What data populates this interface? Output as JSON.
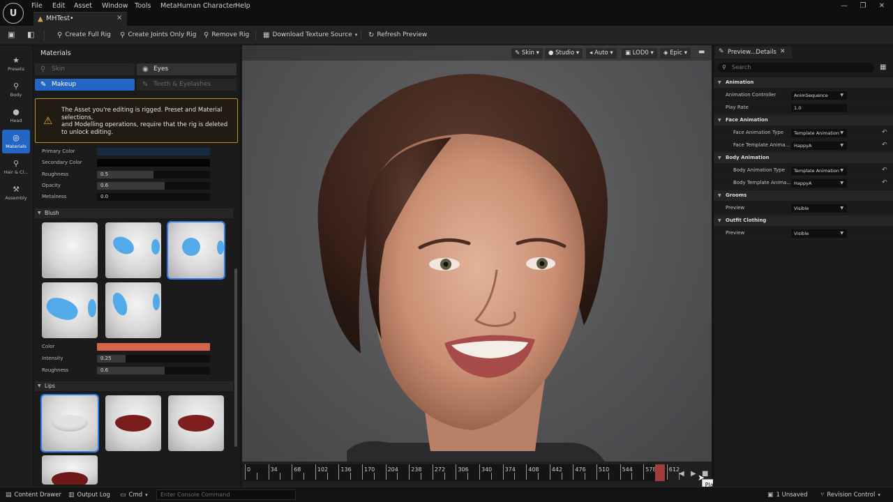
{
  "menu": {
    "items": [
      "File",
      "Edit",
      "Asset",
      "Window",
      "Tools",
      "MetaHuman Character",
      "Help"
    ]
  },
  "document_tab": {
    "label": "MHTest•",
    "close": "×"
  },
  "window_controls": {
    "minimize": "—",
    "maximize": "❐",
    "close": "✕"
  },
  "toolbar": {
    "create_full_rig": "Create Full Rig",
    "create_joints_only_rig": "Create Joints Only Rig",
    "remove_rig": "Remove Rig",
    "download_texture_source": "Download Texture Source",
    "refresh_preview": "Refresh Preview"
  },
  "left_nav": {
    "items": [
      {
        "label": "Presets",
        "icon": "★"
      },
      {
        "label": "Body",
        "icon": "⚲"
      },
      {
        "label": "Head",
        "icon": "●"
      },
      {
        "label": "Materials",
        "icon": "◎"
      },
      {
        "label": "Hair & Cl...",
        "icon": "⚲"
      },
      {
        "label": "Assembly",
        "icon": "⚒"
      }
    ]
  },
  "materials": {
    "title": "Materials",
    "tabs": {
      "skin": "Skin",
      "eyes": "Eyes",
      "makeup": "Makeup",
      "teeth": "Teeth & Eyelashes"
    },
    "warning": {
      "line1": "The Asset you're editing is rigged. Preset and Material selections,",
      "line2": "and Modelling operations, require that the rig is deleted to unlock editing."
    },
    "props": {
      "primary_color": {
        "label": "Primary Color",
        "color": "#162a44"
      },
      "secondary_color": {
        "label": "Secondary Color",
        "color": "#050505"
      },
      "roughness": {
        "label": "Roughness",
        "value": "0.5",
        "fill": 0.5
      },
      "opacity": {
        "label": "Opacity",
        "value": "0.6",
        "fill": 0.6
      },
      "metalness": {
        "label": "Metalness",
        "value": "0.0",
        "fill": 0.0
      }
    },
    "blush": {
      "title": "Blush",
      "color_label": "Color",
      "color": "#d4654a",
      "intensity_label": "Intensity",
      "intensity": "0.25",
      "intensity_fill": 0.25,
      "roughness_label": "Roughness",
      "roughness": "0.6",
      "roughness_fill": 0.6
    },
    "lips": {
      "title": "Lips",
      "lip_color": "#7a1c1c"
    }
  },
  "viewport": {
    "buttons": {
      "skin": "Skin",
      "studio": "Studio",
      "auto": "Auto",
      "lod": "LOD0",
      "epic": "Epic"
    }
  },
  "timeline": {
    "ticks": [
      "0",
      "34",
      "68",
      "102",
      "136",
      "170",
      "204",
      "238",
      "272",
      "306",
      "340",
      "374",
      "408",
      "442",
      "476",
      "510",
      "544",
      "578",
      "612"
    ],
    "tooltip": "Play"
  },
  "details": {
    "tab_label": "Preview...Details",
    "search_placeholder": "Search",
    "sections": {
      "animation": "Animation",
      "face_animation": "Face Animation",
      "body_animation": "Body Animation",
      "grooms": "Grooms",
      "outfit_clothing": "Outfit Clothing"
    },
    "rows": {
      "animation_controller": {
        "label": "Animation Controller",
        "value": "AnimSequence"
      },
      "play_rate": {
        "label": "Play Rate",
        "value": "1.0"
      },
      "face_animation_type": {
        "label": "Face Animation Type",
        "value": "Template Animation"
      },
      "face_template_anim": {
        "label": "Face Template Anima...",
        "value": "HappyA"
      },
      "body_animation_type": {
        "label": "Body Animation Type",
        "value": "Template Animation"
      },
      "body_template_anim": {
        "label": "Body Template Anima...",
        "value": "HappyA"
      },
      "grooms_preview": {
        "label": "Preview",
        "value": "Visible"
      },
      "outfit_preview": {
        "label": "Preview",
        "value": "Visible"
      }
    }
  },
  "statusbar": {
    "content_drawer": "Content Drawer",
    "output_log": "Output Log",
    "cmd": "Cmd",
    "console_placeholder": "Enter Console Command",
    "unsaved": "1 Unsaved",
    "revision_control": "Revision Control"
  }
}
